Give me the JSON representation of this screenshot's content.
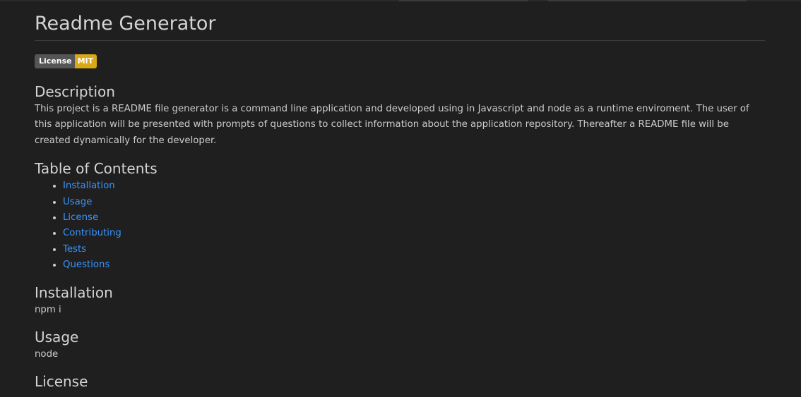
{
  "document": {
    "title": "Readme Generator",
    "badge": {
      "label": "License",
      "value": "MIT",
      "value_color": "#d9a816"
    },
    "sections": {
      "description": {
        "heading": "Description",
        "body": "This project is a README file generator is a command line application and developed using in Javascript and node as a runtime enviroment. The user of this application will be presented with prompts of questions to collect information about the application repository. Thereafter a README file will be created dynamically for the developer."
      },
      "toc": {
        "heading": "Table of Contents",
        "items": [
          {
            "label": "Installation"
          },
          {
            "label": "Usage"
          },
          {
            "label": "License"
          },
          {
            "label": "Contributing"
          },
          {
            "label": "Tests"
          },
          {
            "label": "Questions"
          }
        ]
      },
      "installation": {
        "heading": "Installation",
        "body": "npm i"
      },
      "usage": {
        "heading": "Usage",
        "body": "node"
      },
      "license": {
        "heading": "License"
      }
    }
  },
  "colors": {
    "background": "#1f1f1f",
    "text": "#cccccc",
    "link": "#3794ff"
  }
}
